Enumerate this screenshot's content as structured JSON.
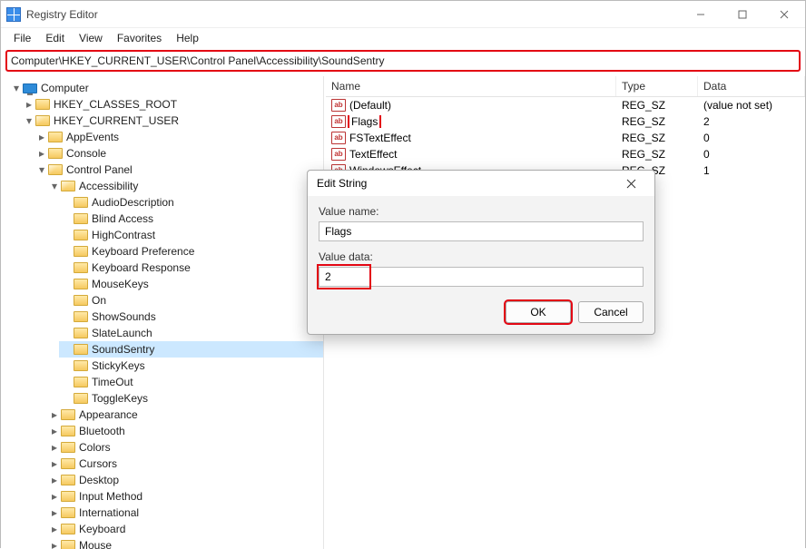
{
  "window": {
    "title": "Registry Editor"
  },
  "menubar": {
    "items": [
      "File",
      "Edit",
      "View",
      "Favorites",
      "Help"
    ]
  },
  "address": "Computer\\HKEY_CURRENT_USER\\Control Panel\\Accessibility\\SoundSentry",
  "tree": {
    "computer": "Computer",
    "hkcr": "HKEY_CLASSES_ROOT",
    "hkcu": "HKEY_CURRENT_USER",
    "hkcu_children": [
      "AppEvents",
      "Console",
      "Control Panel"
    ],
    "access_label": "Accessibility",
    "access_children": [
      "AudioDescription",
      "Blind Access",
      "HighContrast",
      "Keyboard Preference",
      "Keyboard Response",
      "MouseKeys",
      "On",
      "ShowSounds",
      "SlateLaunch",
      "SoundSentry",
      "StickyKeys",
      "TimeOut",
      "ToggleKeys"
    ],
    "cp_siblings": [
      "Appearance",
      "Bluetooth",
      "Colors",
      "Cursors",
      "Desktop",
      "Input Method",
      "International",
      "Keyboard",
      "Mouse"
    ]
  },
  "list": {
    "headers": {
      "name": "Name",
      "type": "Type",
      "data": "Data"
    },
    "rows": [
      {
        "name": "(Default)",
        "type": "REG_SZ",
        "data": "(value not set)",
        "hl": false
      },
      {
        "name": "Flags",
        "type": "REG_SZ",
        "data": "2",
        "hl": true
      },
      {
        "name": "FSTextEffect",
        "type": "REG_SZ",
        "data": "0",
        "hl": false
      },
      {
        "name": "TextEffect",
        "type": "REG_SZ",
        "data": "0",
        "hl": false
      },
      {
        "name": "WindowsEffect",
        "type": "REG_SZ",
        "data": "1",
        "hl": false
      }
    ]
  },
  "dialog": {
    "title": "Edit String",
    "value_name_label": "Value name:",
    "value_name": "Flags",
    "value_data_label": "Value data:",
    "value_data": "2",
    "ok": "OK",
    "cancel": "Cancel"
  }
}
